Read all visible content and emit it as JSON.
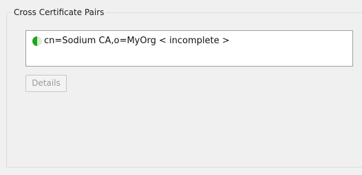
{
  "group": {
    "title": "Cross Certificate Pairs"
  },
  "pairs": {
    "items": [
      {
        "label": "cn=Sodium CA,o=MyOrg < incomplete >",
        "icon": "half-green-circle-icon"
      }
    ]
  },
  "buttons": {
    "details_label": "Details",
    "details_enabled": false
  },
  "colors": {
    "icon_green": "#1fa51f",
    "panel_background": "#f0f0f0"
  }
}
